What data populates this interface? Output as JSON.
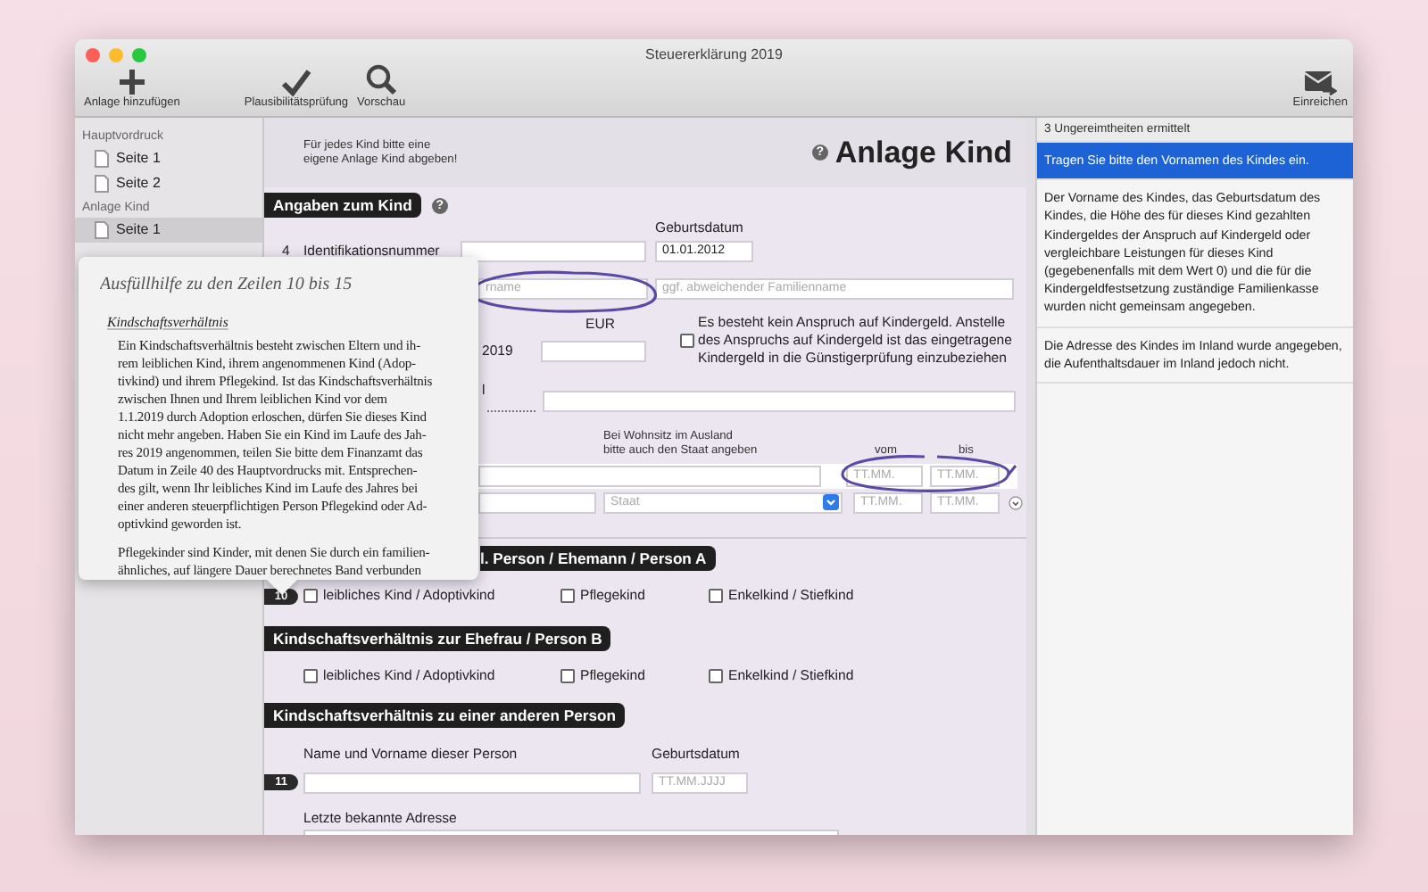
{
  "window": {
    "title": "Steuererklärung 2019"
  },
  "toolbar": {
    "left": [
      {
        "label": "Anlage hinzufügen"
      },
      {
        "label": "Plausibilitätsprüfung"
      },
      {
        "label": "Vorschau"
      }
    ],
    "right": [
      {
        "label": "Einreichen"
      }
    ]
  },
  "sidebar": {
    "groups": [
      {
        "title": "Hauptvordruck",
        "items": [
          {
            "label": "Seite 1",
            "selected": false
          },
          {
            "label": "Seite 2",
            "selected": false
          }
        ]
      },
      {
        "title": "Anlage Kind",
        "items": [
          {
            "label": "Seite 1",
            "selected": true
          }
        ]
      }
    ]
  },
  "form": {
    "notice_lines": [
      "Für jedes Kind bitte eine",
      "eigene Anlage Kind abgeben!"
    ],
    "title_help": "?",
    "title": "Anlage Kind",
    "section_1": "Angaben zum Kind",
    "section_1_help": "?",
    "birth_label": "Geburtsdatum",
    "line_4": {
      "number": "4",
      "label": "Identifikationsnummer",
      "birth_date": "01.01.2012"
    },
    "name_row": {
      "first_name_placeholder": "rname",
      "family_name_placeholder": "ggf. abweichender Familienname"
    },
    "currency": "EUR",
    "year": "2019",
    "no_claim": {
      "checked": false,
      "lines": [
        "Es besteht kein Anspruch auf Kindergeld. Anstelle",
        "des Anspruchs auf Kindergeld ist das eingetragene",
        "Kindergeld in die Günstigerprüfung einzubeziehen"
      ]
    },
    "label_fragment": "l",
    "abroad_note_lines": [
      "Bei Wohnsitz im Ausland",
      "bitte auch den Staat angeben"
    ],
    "from_label": "vom",
    "to_label": "bis",
    "residence_rows": [
      {
        "from_placeholder": "TT.MM.",
        "to_placeholder": "TT.MM."
      },
      {
        "state_placeholder": "Staat",
        "from_placeholder": "TT.MM.",
        "to_placeholder": "TT.MM."
      }
    ],
    "section_2_fragment": "l. Person / Ehemann / Person A",
    "relations": [
      {
        "number": "10",
        "options": [
          {
            "label": "leibliches Kind / Adoptivkind",
            "checked": false
          },
          {
            "label": "Pflegekind",
            "checked": false
          },
          {
            "label": "Enkelkind / Stiefkind",
            "checked": false
          }
        ]
      },
      {
        "title": "Kindschaftsverhältnis zur Ehefrau / Person B",
        "options": [
          {
            "label": "leibliches Kind / Adoptivkind",
            "checked": false
          },
          {
            "label": "Pflegekind",
            "checked": false
          },
          {
            "label": "Enkelkind / Stiefkind",
            "checked": false
          }
        ]
      }
    ],
    "section_4": "Kindschaftsverhältnis zu einer anderen Person",
    "other_person": {
      "name_label": "Name und Vorname dieser Person",
      "birth_label": "Geburtsdatum",
      "number": "11",
      "birth_placeholder": "TT.MM.JJJJ",
      "address_label": "Letzte bekannte Adresse"
    }
  },
  "help_popover": {
    "title": "Ausfüllhilfe zu den Zeilen 10 bis 15",
    "heading": "Kindschaftsverhältnis",
    "paragraphs": [
      [
        "Ein Kindschaftsverhältnis besteht zwischen Eltern und ih-",
        "rem leiblichen Kind, ihrem angenommenen Kind (Adop-",
        "tivkind) und ihrem Pflegekind. Ist das Kindschaftsverhältnis",
        "zwischen Ihnen und Ihrem leiblichen Kind vor dem",
        "1.1.2019 durch Adoption erloschen, dürfen Sie dieses Kind",
        "nicht mehr angeben. Haben Sie ein Kind im Laufe des Jah-",
        "res 2019 angenommen, teilen Sie bitte dem Finanzamt das",
        "Datum in Zeile 40 des Hauptvordrucks mit. Entsprechen-",
        "des gilt, wenn Ihr leibliches Kind im Laufe des Jahres bei",
        "einer anderen steuerpflichtigen Person Pflegekind oder Ad-",
        "optivkind geworden ist."
      ],
      [
        "Pflegekinder sind Kinder, mit denen Sie durch ein familien-",
        "ähnliches, auf längere Dauer berechnetes Band verbunden"
      ]
    ]
  },
  "issues": {
    "summary": "3 Ungereimtheiten ermittelt",
    "items": [
      {
        "text": "Tragen Sie bitte den Vornamen des Kindes ein.",
        "selected": true
      },
      {
        "text": "Der Vorname des Kindes, das Geburtsdatum des Kindes, die Höhe des für dieses Kind gezahlten Kindergeldes der Anspruch auf Kindergeld oder vergleichbare Leistungen für dieses Kind (gegebenenfalls mit dem Wert 0) und die für die Kindergeldfestsetzung zuständige Familienkasse wurden nicht gemeinsam angegeben.",
        "selected": false
      },
      {
        "text": "Die Adresse des Kindes im Inland wurde angegeben, die Aufenthaltsdauer im Inland jedoch nicht.",
        "selected": false
      }
    ]
  }
}
